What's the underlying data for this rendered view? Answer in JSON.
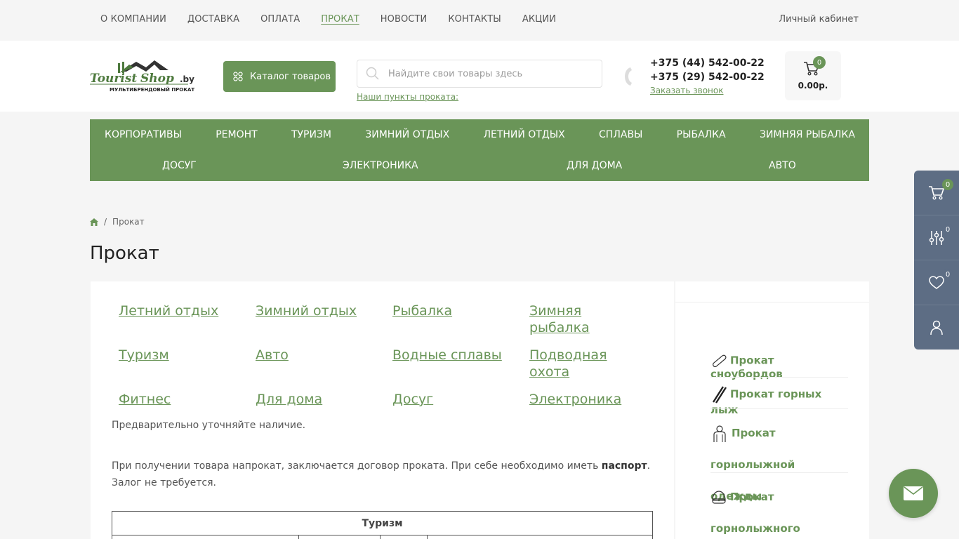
{
  "topnav": {
    "items": [
      "О КОМПАНИИ",
      "ДОСТАВКА",
      "ОПЛАТА",
      "ПРОКАТ",
      "НОВОСТИ",
      "КОНТАКТЫ",
      "АКЦИИ"
    ],
    "active": "ПРОКАТ",
    "account": "Личный кабинет"
  },
  "header": {
    "logo_text": "TouristShop.by",
    "logo_tagline": "МУЛЬТИБРЕНДОВЫЙ ПРОКАТ",
    "catalog_button": "Каталог товаров",
    "search_placeholder": "Найдите свои товары здесь",
    "rental_points": "Наши пункты проката:",
    "phone1": "+375 (44) 542-00-22",
    "phone2": "+375 (29) 542-00-22",
    "callback": "Заказать звонок",
    "cart_count": "0",
    "cart_total": "0.00р."
  },
  "menu": {
    "row1": [
      "КОРПОРАТИВЫ",
      "РЕМОНТ",
      "ТУРИЗМ",
      "ЗИМНИЙ ОТДЫХ",
      "ЛЕТНИЙ ОТДЫХ",
      "СПЛАВЫ",
      "РЫБАЛКА",
      "ЗИМНЯЯ РЫБАЛКА"
    ],
    "row2": [
      "ДОСУГ",
      "ЭЛЕКТРОНИКА",
      "ДЛЯ ДОМА",
      "АВТО"
    ]
  },
  "breadcrumb": {
    "current": "Прокат"
  },
  "page_title": "Прокат",
  "categories": [
    [
      "Летний отдых",
      "Зимний отдых",
      "Рыбалка",
      "Зимняя рыбалка"
    ],
    [
      "Туризм",
      "Авто",
      "Водные сплавы",
      "Подводная охота"
    ],
    [
      "Фитнес",
      "Для дома",
      "Досуг",
      "Электроника"
    ]
  ],
  "notes": {
    "availability": "Предварительно уточняйте наличие.",
    "contract_pre": "При получении товара напрокат, заключается договор проката. При себе необходимо иметь ",
    "contract_bold": "паспорт",
    "contract_post": ". Залог не требуется."
  },
  "table": {
    "header": "Туризм"
  },
  "sidebar": {
    "items": [
      "Прокат сноубордов",
      "Прокат горных лыж",
      "Прокат горнолыжной одежды",
      "Прокат горнолыжного"
    ]
  },
  "float_panel": {
    "cart_count": "0",
    "compare_count": "0",
    "favorites_count": "0"
  },
  "colors": {
    "accent": "#6a9558",
    "panel": "#5d6d84"
  }
}
